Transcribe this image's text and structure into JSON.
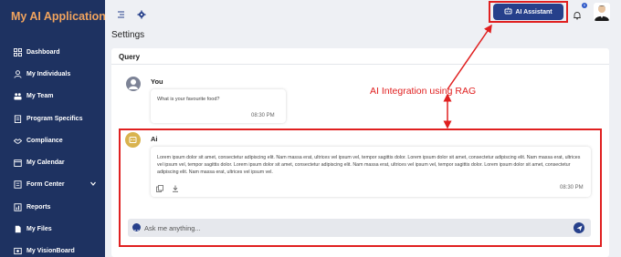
{
  "app": {
    "title": "My AI Application"
  },
  "sidebar": {
    "items": [
      {
        "label": "Dashboard",
        "icon": "grid-icon"
      },
      {
        "label": "My Individuals",
        "icon": "person-icon"
      },
      {
        "label": "My Team",
        "icon": "team-icon"
      },
      {
        "label": "Program Specifics",
        "icon": "clipboard-icon"
      },
      {
        "label": "Compliance",
        "icon": "handshake-icon"
      },
      {
        "label": "My Calendar",
        "icon": "calendar-icon"
      },
      {
        "label": "Form Center",
        "icon": "form-icon",
        "has_submenu": true
      },
      {
        "label": "Reports",
        "icon": "report-icon"
      },
      {
        "label": "My Files",
        "icon": "file-icon"
      },
      {
        "label": "My VisionBoard",
        "icon": "board-icon"
      }
    ]
  },
  "topbar": {
    "ai_assistant_label": "AI Assistant",
    "notification_count": "0"
  },
  "page": {
    "title": "Settings"
  },
  "query": {
    "title": "Query",
    "user_message": {
      "name": "You",
      "text": "What is your favourite food?",
      "time": "08:30 PM"
    },
    "ai_message": {
      "name": "Ai",
      "text": "Lorem ipsum dolor sit amet, consectetur adipiscing elit. Nam massa erat, ultrices vel ipsum vel, tempor sagittis dolor. Lorem ipsum dolor sit amet, consectetur adipiscing elit. Nam massa erat, ultrices vel ipsum vel, tempor sagittis dolor. Lorem ipsum dolor sit amet, consectetur adipiscing elit. Nam massa erat, ultrices vel ipsum vel, tempor sagittis dolor. Lorem ipsum dolor sit amet, consectetur adipiscing elit. Nam massa erat, ultrices vel ipsum vel.",
      "time": "08:30 PM"
    },
    "input": {
      "placeholder": "Ask me anything..."
    }
  },
  "annotation": {
    "text": "AI Integration using RAG",
    "color": "#e02020"
  },
  "colors": {
    "sidebar_bg": "#1e3261",
    "title_accent": "#f0a35e",
    "primary": "#26408b"
  }
}
